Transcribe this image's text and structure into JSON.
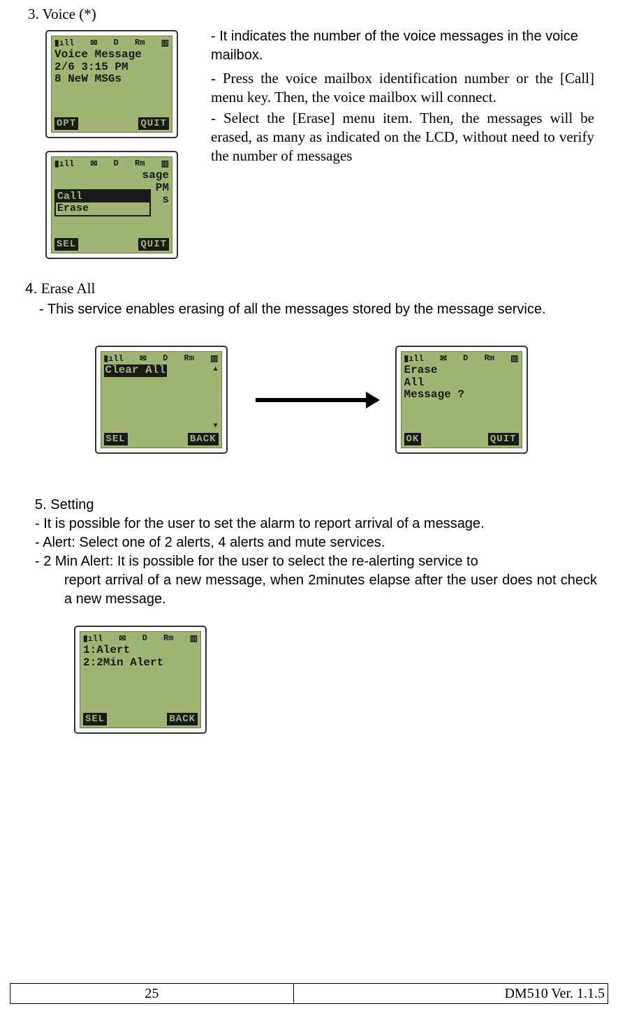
{
  "section3": {
    "title": "3.    Voice (*)",
    "lead": "- It indicates the number of the voice messages in the voice mailbox.",
    "body1": "- Press the voice mailbox identification number or the [Call] menu key. Then, the voice mailbox will connect.",
    "body2": "- Select the [Erase] menu item. Then, the messages will be erased, as many as indicated on the LCD, without need to verify the number of messages"
  },
  "lcd_common": {
    "sig": "▮ıll",
    "env": "✉",
    "d": "D",
    "rm": "Rm",
    "bat": "▥"
  },
  "lcd1": {
    "line1": "Voice Message",
    "line2": "2/6 3:15 PM",
    "line3": "8 NeW MSGs",
    "left": "OPT",
    "right": "QUIT"
  },
  "lcd2": {
    "bg": "sage",
    "popup_sel": "Call",
    "popup_unsel": "Erase",
    "extra": "PM",
    "extra2": "s",
    "left": "SEL",
    "right": "QUIT"
  },
  "section4": {
    "title_num": "4.",
    "title_rest": " Erase All",
    "desc": "- This service enables erasing of all the messages stored by the message service."
  },
  "lcd3": {
    "line1": "Clear All",
    "left": "SEL",
    "right": "BACK",
    "up": "▲",
    "down": "▼"
  },
  "lcd4": {
    "line1": "Erase",
    "line2": "All",
    "line3": "Message ?",
    "left": "OK",
    "right": "QUIT"
  },
  "section5": {
    "title": "5. Setting",
    "b1": "-  It is possible for the user to set the alarm to report arrival of a message.",
    "b2": "-  Alert: Select one of 2 alerts, 4 alerts and mute services.",
    "b3": "-  2 Min Alert: It is possible for the user to select the re-alerting service to",
    "b3_cont": "report arrival of a new message, when 2minutes elapse after the user does not check a new message."
  },
  "lcd5": {
    "line1": "1:Alert",
    "line2": "2:2Min Alert",
    "left": "SEL",
    "right": "BACK"
  },
  "footer": {
    "page": "25",
    "doc": "DM510    Ver. 1.1.5"
  }
}
